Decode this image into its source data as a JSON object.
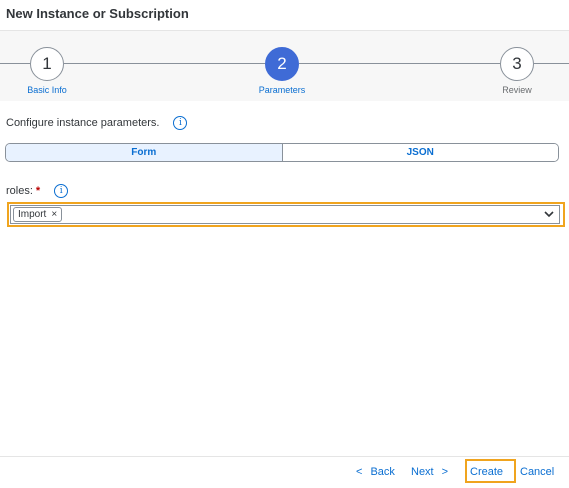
{
  "dialog": {
    "title": "New Instance or Subscription"
  },
  "wizard": {
    "steps": [
      {
        "number": "1",
        "label": "Basic Info",
        "state": "inactive"
      },
      {
        "number": "2",
        "label": "Parameters",
        "state": "active"
      },
      {
        "number": "3",
        "label": "Review",
        "state": "inactive"
      }
    ]
  },
  "parameters": {
    "configure_text": "Configure instance parameters.",
    "info_icon": "information-icon",
    "mode_tabs": [
      {
        "label": "Form",
        "selected": true
      },
      {
        "label": "JSON",
        "selected": false
      }
    ]
  },
  "roles": {
    "label": "roles:",
    "required_mark": "*",
    "tokens": [
      "Import"
    ],
    "remove_symbol": "×",
    "input_value": ""
  },
  "footer": {
    "back_label": "Back",
    "back_symbol": "<",
    "next_label": "Next",
    "next_symbol": ">",
    "create_label": "Create",
    "cancel_label": "Cancel"
  },
  "colors": {
    "accent": "#0a6ed1",
    "active_step": "#3f6bd6",
    "highlight": "#f0a41e",
    "required": "#bb0000"
  }
}
